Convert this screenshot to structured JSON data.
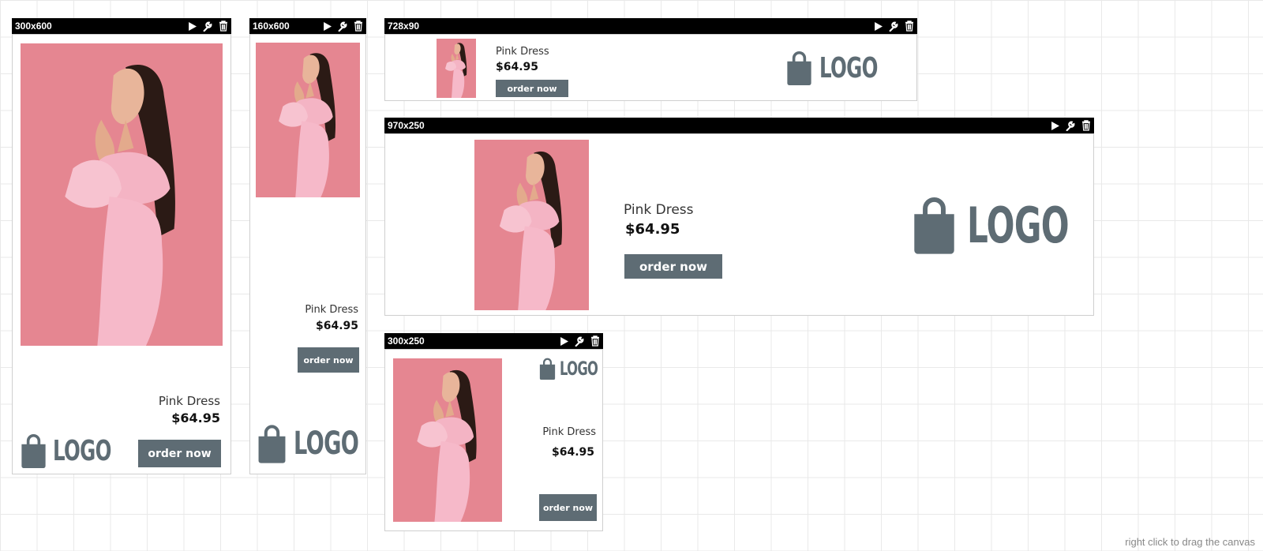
{
  "product": {
    "name": "Pink Dress",
    "price": "$64.95",
    "cta": "order now",
    "logo_text": "LOGO"
  },
  "banners": [
    {
      "size_label": "300x600"
    },
    {
      "size_label": "160x600"
    },
    {
      "size_label": "728x90"
    },
    {
      "size_label": "970x250"
    },
    {
      "size_label": "300x250"
    }
  ],
  "toolbar_icons": [
    "play-icon",
    "wrench-icon",
    "trash-icon"
  ],
  "canvas_hint": "right click to drag the canvas",
  "colors": {
    "accent": "#5e6c74",
    "bar": "#000000",
    "photo_bg": "#e27b88",
    "dress": "#f6b9c9"
  }
}
